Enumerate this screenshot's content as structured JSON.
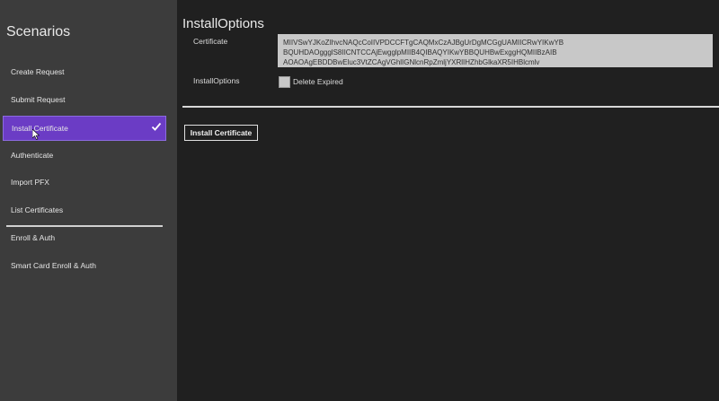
{
  "sidebar": {
    "title": "Scenarios",
    "items": [
      {
        "label": "Create Request"
      },
      {
        "label": "Submit Request"
      },
      {
        "label": "Install Certificate"
      },
      {
        "label": "Authenticate"
      },
      {
        "label": "Import PFX"
      },
      {
        "label": "List Certificates"
      },
      {
        "label": "Enroll & Auth"
      },
      {
        "label": "Smart Card Enroll & Auth"
      }
    ],
    "selected_icon": "checkmark-icon"
  },
  "main": {
    "title": "InstallOptions",
    "certificate_label": "Certificate",
    "certificate_lines": [
      "MIIVSwYJKoZIhvcNAQcCoIIVPDCCFTgCAQMxCzAJBgUrDgMCGgUAMIICRwYIKwYB",
      "BQUHDAOggglS8IICNTCCAjEwgglpMIIB4QIBAQYIKwYBBQUHBwExggHQMIIBzAIB",
      "AOAOAgEBDDBwEluc3VtZCAgVGhlIGNlcnRpZmljYXRlIHZhbGlkaXR5IHBlcmlv"
    ],
    "install_options_label": "InstallOptions",
    "delete_expired_label": "Delete Expired",
    "delete_expired_checked": false,
    "install_button_label": "Install Certificate"
  },
  "colors": {
    "sidebar_bg": "#3c3c3c",
    "main_bg": "#202020",
    "accent": "#6b3cc5"
  }
}
